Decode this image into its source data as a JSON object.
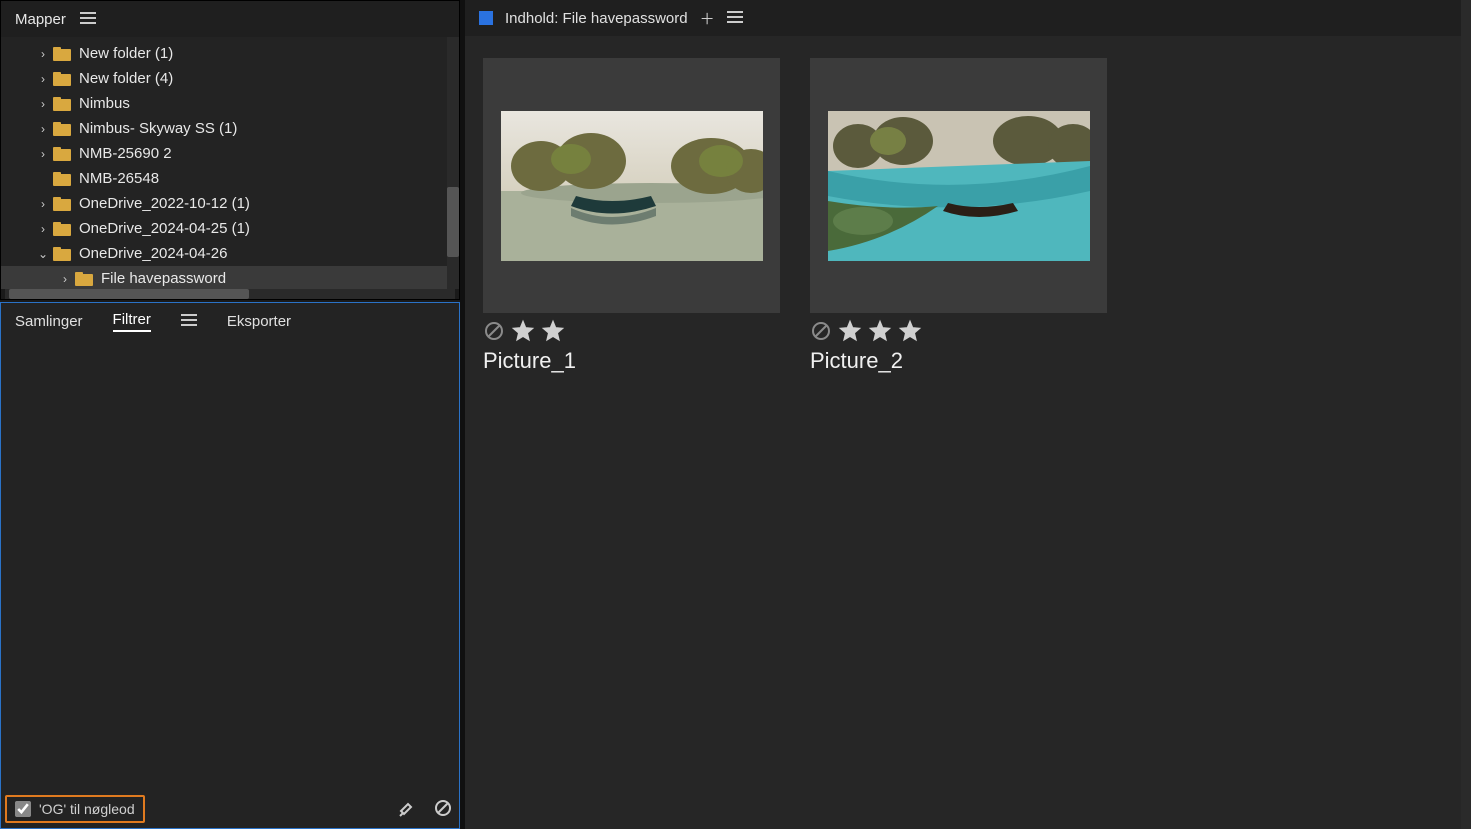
{
  "folders_panel": {
    "title": "Mapper",
    "tree": [
      {
        "indent": 1,
        "chev": "right",
        "label": "New folder (1)"
      },
      {
        "indent": 1,
        "chev": "right",
        "label": "New folder (4)"
      },
      {
        "indent": 1,
        "chev": "right",
        "label": "Nimbus"
      },
      {
        "indent": 1,
        "chev": "right",
        "label": "Nimbus- Skyway SS (1)"
      },
      {
        "indent": 1,
        "chev": "right",
        "label": "NMB-25690 2"
      },
      {
        "indent": 1,
        "chev": "none",
        "label": "NMB-26548"
      },
      {
        "indent": 1,
        "chev": "right",
        "label": "OneDrive_2022-10-12 (1)"
      },
      {
        "indent": 1,
        "chev": "right",
        "label": "OneDrive_2024-04-25 (1)"
      },
      {
        "indent": 1,
        "chev": "down",
        "label": "OneDrive_2024-04-26"
      },
      {
        "indent": 2,
        "chev": "right",
        "label": "File havepassword",
        "selected": true
      }
    ]
  },
  "filter_panel": {
    "tabs": {
      "samlinger": "Samlinger",
      "filtrer": "Filtrer",
      "eksporter": "Eksporter"
    },
    "active_tab": "filtrer",
    "footer": {
      "og_label": "'OG' til nøgleod",
      "og_checked": true
    }
  },
  "content": {
    "header_title": "Indhold: File havepassword",
    "items": [
      {
        "name": "Picture_1",
        "stars": 2
      },
      {
        "name": "Picture_2",
        "stars": 3
      }
    ]
  }
}
